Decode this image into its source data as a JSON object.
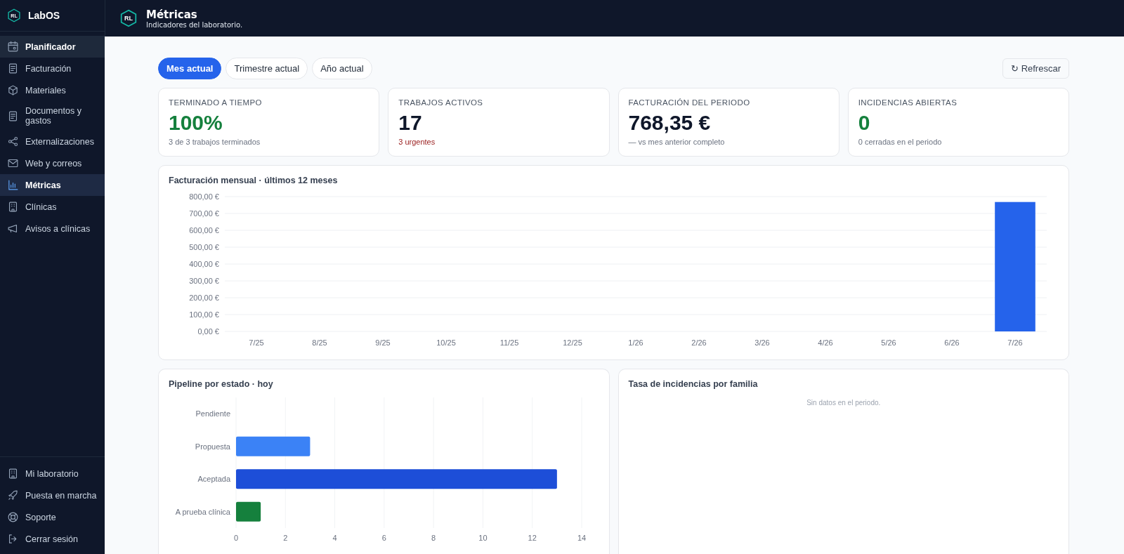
{
  "sidebar": {
    "brand": {
      "logo": "RL",
      "name": "LabOS"
    },
    "items": [
      {
        "label": "Planificador",
        "selected": false,
        "hovered": true
      },
      {
        "label": "Facturación",
        "selected": false,
        "hovered": false
      },
      {
        "label": "Materiales",
        "selected": false,
        "hovered": false
      },
      {
        "label": "Documentos y gastos",
        "selected": false,
        "hovered": false
      },
      {
        "label": "Externalizaciones",
        "selected": false,
        "hovered": false
      },
      {
        "label": "Web y correos",
        "selected": false,
        "hovered": false
      },
      {
        "label": "Métricas",
        "selected": true,
        "hovered": false
      },
      {
        "label": "Clínicas",
        "selected": false,
        "hovered": false
      },
      {
        "label": "Avisos a clínicas",
        "selected": false,
        "hovered": false
      }
    ],
    "footer_items": [
      {
        "label": "Mi laboratorio"
      },
      {
        "label": "Puesta en marcha"
      },
      {
        "label": "Soporte"
      },
      {
        "label": "Cerrar sesión"
      }
    ]
  },
  "header": {
    "logo": "RL",
    "title": "Métricas",
    "subtitle": "Indicadores del laboratorio."
  },
  "period_tabs": [
    {
      "label": "Mes actual",
      "selected": true
    },
    {
      "label": "Trimestre actual",
      "selected": false
    },
    {
      "label": "Año actual",
      "selected": false
    }
  ],
  "refresh_button": {
    "icon": "↻",
    "label": "Refrescar"
  },
  "kpis": [
    {
      "label": "TERMINADO A TIEMPO",
      "value": "100%",
      "color": "#15803d",
      "note": {
        "text": "3 de 3 trabajos terminados",
        "color": "#6b7280"
      }
    },
    {
      "label": "TRABAJOS ACTIVOS",
      "value": "17",
      "color": "#0f172a",
      "note": {
        "text": "3 urgentes",
        "color": "#991b1b"
      }
    },
    {
      "label": "FACTURACIÓN DEL PERIODO",
      "value": "768,35 €",
      "color": "#0f172a",
      "note": {
        "text": "— vs mes anterior completo",
        "color": "#6b7280"
      }
    },
    {
      "label": "INCIDENCIAS ABIERTAS",
      "value": "0",
      "color": "#15803d",
      "note": {
        "text": "0 cerradas en el periodo",
        "color": "#6b7280"
      }
    }
  ],
  "monthly_billing": {
    "title": "Facturación mensual · últimos 12 meses",
    "chart_data": {
      "type": "bar",
      "grid": true,
      "categories": [
        "7/25",
        "8/25",
        "9/25",
        "10/25",
        "11/25",
        "12/25",
        "1/26",
        "2/26",
        "3/26",
        "4/26",
        "5/26",
        "6/26",
        "7/26"
      ],
      "series": [
        {
          "color": "#2563eb",
          "values": [
            0,
            0,
            0,
            0,
            0,
            0,
            0,
            0,
            0,
            0,
            0,
            0,
            768
          ]
        }
      ],
      "ylim": [
        0,
        800
      ],
      "yticks": [
        {
          "value": 0,
          "label": "0,00 €"
        },
        {
          "value": 100,
          "label": "100,00 €"
        },
        {
          "value": 200,
          "label": "200,00 €"
        },
        {
          "value": 300,
          "label": "300,00 €"
        },
        {
          "value": 400,
          "label": "400,00 €"
        },
        {
          "value": 500,
          "label": "500,00 €"
        },
        {
          "value": 600,
          "label": "600,00 €"
        },
        {
          "value": 700,
          "label": "700,00 €"
        },
        {
          "value": 800,
          "label": "800,00 €"
        }
      ]
    }
  },
  "pipeline": {
    "title": "Pipeline por estado · hoy",
    "chart_data": {
      "type": "bar",
      "orientation": "horizontal",
      "grid": true,
      "categories": [
        "Pendiente",
        "Propuesta",
        "Aceptada",
        "A prueba clínica"
      ],
      "series": [
        {
          "color": "#3b82f6",
          "values": [
            0,
            3,
            null,
            null
          ]
        },
        {
          "color": "#1d4ed8",
          "values": [
            null,
            null,
            13,
            null
          ]
        },
        {
          "color": "#15803d",
          "values": [
            null,
            null,
            null,
            1
          ]
        }
      ],
      "xlim": [
        0,
        14
      ],
      "xticks": [
        0,
        2,
        4,
        6,
        8,
        10,
        12,
        14
      ]
    }
  },
  "incident_rate": {
    "title": "Tasa de incidencias por familia",
    "empty_message": "Sin datos en el periodo."
  }
}
